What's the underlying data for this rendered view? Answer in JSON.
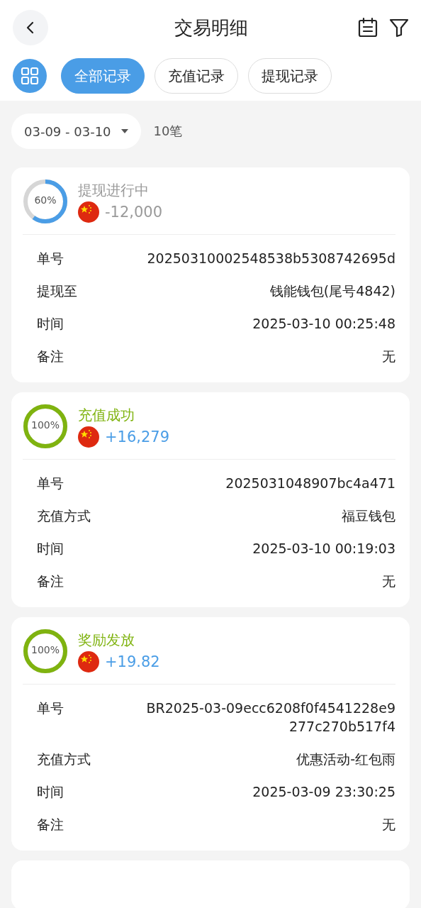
{
  "header": {
    "title": "交易明细"
  },
  "tabs": [
    {
      "label": "全部记录",
      "selected": true
    },
    {
      "label": "充值记录",
      "selected": false
    },
    {
      "label": "提现记录",
      "selected": false
    }
  ],
  "filter": {
    "date_range": "03-09 - 03-10",
    "count": "10笔"
  },
  "records": [
    {
      "kind": "pending",
      "level": 0.6,
      "percent": "60%",
      "status": "提现进行中",
      "amount": "-12,000",
      "rows": [
        {
          "label": "单号",
          "value": "20250310002548538b5308742695d"
        },
        {
          "label": "提现至",
          "value": "钱能钱包(尾号4842)"
        },
        {
          "label": "时间",
          "value": "2025-03-10 00:25:48"
        },
        {
          "label": "备注",
          "value": "无"
        }
      ]
    },
    {
      "kind": "success",
      "level": 1,
      "percent": "100%",
      "status": "充值成功",
      "amount": "+16,279",
      "rows": [
        {
          "label": "单号",
          "value": "2025031048907bc4a471"
        },
        {
          "label": "充值方式",
          "value": "福豆钱包"
        },
        {
          "label": "时间",
          "value": "2025-03-10 00:19:03"
        },
        {
          "label": "备注",
          "value": "无"
        }
      ]
    },
    {
      "kind": "success",
      "level": 1,
      "percent": "100%",
      "status": "奖励发放",
      "amount": "+19.82",
      "rows": [
        {
          "label": "单号",
          "value": "BR2025-03-09ecc6208f0f4541228e9277c270b517f4"
        },
        {
          "label": "充值方式",
          "value": "优惠活动-红包雨"
        },
        {
          "label": "时间",
          "value": "2025-03-09 23:30:25"
        },
        {
          "label": "备注",
          "value": "无"
        }
      ]
    }
  ]
}
